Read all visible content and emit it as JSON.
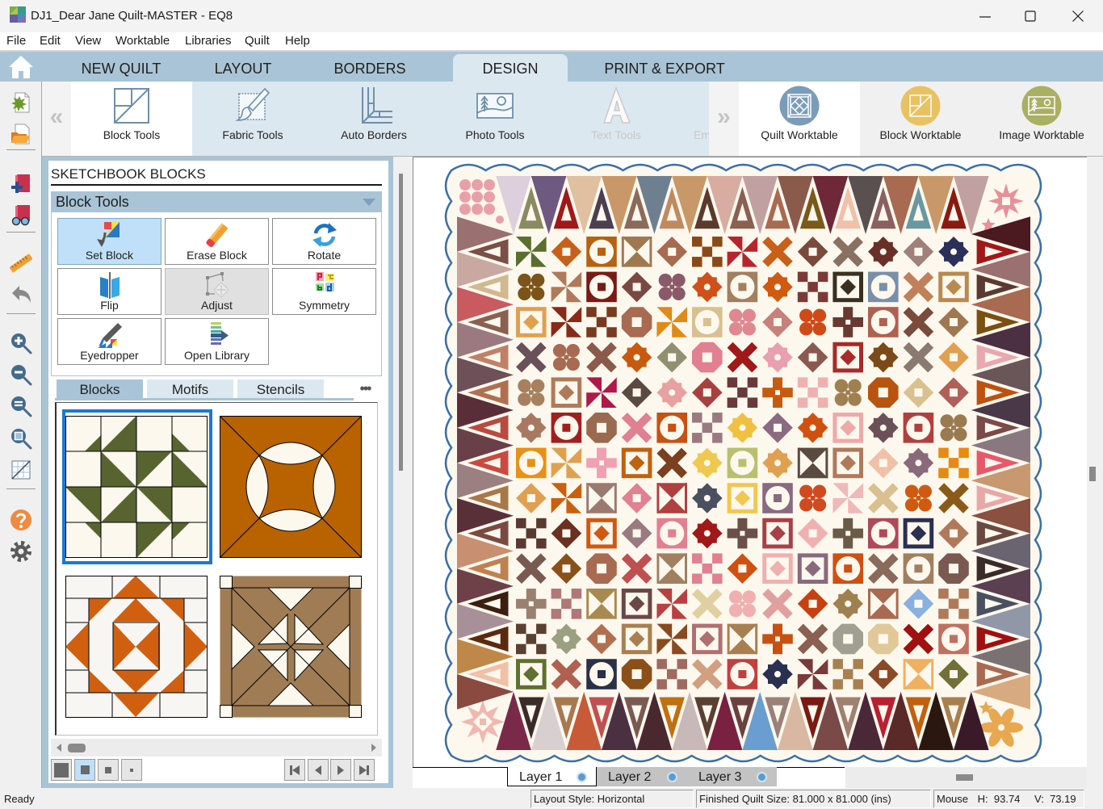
{
  "window": {
    "title": "DJ1_Dear Jane Quilt-MASTER - EQ8",
    "controls": [
      "minimize-icon",
      "maximize-icon",
      "close-icon"
    ]
  },
  "menu": [
    {
      "label": "File"
    },
    {
      "label": "Edit"
    },
    {
      "label": "View"
    },
    {
      "label": "Worktable"
    },
    {
      "label": "Libraries"
    },
    {
      "label": "Quilt"
    },
    {
      "label": "Help"
    }
  ],
  "tabs": [
    {
      "label": "NEW QUILT"
    },
    {
      "label": "LAYOUT"
    },
    {
      "label": "BORDERS"
    },
    {
      "label": "DESIGN",
      "active": true
    },
    {
      "label": "PRINT & EXPORT"
    }
  ],
  "ribbon": {
    "scroll_left": "«",
    "scroll_right": "»",
    "tools": [
      {
        "label": "Block Tools",
        "state": "active"
      },
      {
        "label": "Fabric Tools",
        "state": "normal"
      },
      {
        "label": "Auto Borders",
        "state": "normal"
      },
      {
        "label": "Photo Tools",
        "state": "normal"
      },
      {
        "label": "Text Tools",
        "state": "disabled"
      },
      {
        "label": "Em",
        "state": "disabled"
      }
    ],
    "worktables": [
      {
        "label": "Quilt Worktable",
        "color": "#7a9cb8",
        "state": "active"
      },
      {
        "label": "Block Worktable",
        "color": "#e8c262"
      },
      {
        "label": "Image Worktable",
        "color": "#aab062"
      }
    ]
  },
  "toolbar_left": [
    "new-quilt",
    "open-project",
    "add-to-sketchbook",
    "view-sketchbook",
    "ruler",
    "undo",
    "zoom-in",
    "zoom-out",
    "fit-to-worktable",
    "zoom-window",
    "show-grid",
    "help",
    "settings"
  ],
  "panel": {
    "title": "SKETCHBOOK BLOCKS",
    "section": "Block Tools",
    "tools": [
      {
        "label": "Set Block",
        "state": "active"
      },
      {
        "label": "Erase Block"
      },
      {
        "label": "Rotate"
      },
      {
        "label": "Flip"
      },
      {
        "label": "Adjust",
        "state": "disabled"
      },
      {
        "label": "Symmetry"
      },
      {
        "label": "Eyedropper"
      },
      {
        "label": "Open Library"
      }
    ],
    "tabs": [
      {
        "label": "Blocks",
        "active": true
      },
      {
        "label": "Motifs"
      },
      {
        "label": "Stencils"
      }
    ],
    "more": "•••",
    "thumbnails": [
      {
        "background": "#fdf8ee",
        "color": "#586430",
        "selected": true
      },
      {
        "background": "#b86200",
        "color": "#fdf8ee"
      },
      {
        "background": "#f8f6f2",
        "color": "#d06010"
      },
      {
        "background": "#a07c54",
        "color": "#fdf8ee"
      }
    ],
    "view_sizes": [
      {
        "size": "large"
      },
      {
        "size": "medium",
        "active": true
      },
      {
        "size": "small"
      },
      {
        "size": "tiny"
      }
    ],
    "nav": [
      "first",
      "previous",
      "next",
      "last"
    ]
  },
  "canvas": {
    "quilt": {
      "background": "#fdf8ee",
      "binding": "#3a6ea8",
      "blocks": {
        "colors": [
          [
            "#5a6e2e",
            "#c8601a",
            "#b8620f",
            "#a07850",
            "#a86a50",
            "#8a4a18",
            "#b8242e",
            "#c86018",
            "#7a4a3a",
            "#8a7060",
            "#6a3028",
            "#a08078",
            "#2a3058"
          ],
          [
            "#7a5418",
            "#b07a5a",
            "#7a1a14",
            "#7a4a42",
            "#8a5a68",
            "#d0501a",
            "#a08060",
            "#d05a10",
            "#7a3a38",
            "#3a3020",
            "#7890a8",
            "#c0805a",
            "#b88a50"
          ],
          [
            "#e0a050",
            "#8a2a18",
            "#7a3a20",
            "#a86a50",
            "#e08a18",
            "#d8c090",
            "#e08890",
            "#c8807a",
            "#d04a18",
            "#6a3a30",
            "#b06050",
            "#7a4a3a",
            "#a07850"
          ],
          [
            "#6a5058",
            "#a86a50",
            "#8a5a4a",
            "#c85a10",
            "#909070",
            "#e08090",
            "#a01818",
            "#e8a0b0",
            "#8a5a50",
            "#a82a2a",
            "#7a4a18",
            "#8a7a70",
            "#e0a050"
          ],
          [
            "#a88060",
            "#b07a5a",
            "#b01848",
            "#5a4a40",
            "#e8a0a0",
            "#a84040",
            "#6a3a3a",
            "#c85a10",
            "#f0b0b0",
            "#a08050",
            "#b85410",
            "#d8c090",
            "#b06058"
          ],
          [
            "#a87860",
            "#a02020",
            "#9a6a50",
            "#e08090",
            "#c85010",
            "#9a7a80",
            "#f0c040",
            "#8a6a80",
            "#d05010",
            "#f0a8a8",
            "#6a5058",
            "#b04040",
            "#9a7a50"
          ],
          [
            "#e89018",
            "#e0a050",
            "#f0a0b0",
            "#c06010",
            "#7a4020",
            "#f0c850",
            "#b8c070",
            "#e0a050",
            "#5a4a40",
            "#b07a5a",
            "#f0c0a8",
            "#8a6a7a",
            "#e88a10"
          ],
          [
            "#e0a050",
            "#c86010",
            "#9a7a70",
            "#e08090",
            "#b04040",
            "#4a5060",
            "#f0c850",
            "#8a6a80",
            "#d04a20",
            "#f0b8b8",
            "#d8c090",
            "#d05a10",
            "#8a5a18"
          ],
          [
            "#5a3a30",
            "#6a3020",
            "#d05810",
            "#9a7a80",
            "#e08090",
            "#a01818",
            "#6a5048",
            "#a84048",
            "#f0b0b0",
            "#6a5a48",
            "#b04858",
            "#2a3050",
            "#b07a5a"
          ],
          [
            "#7a5a50",
            "#8a5018",
            "#a86a50",
            "#c05050",
            "#a08060",
            "#e08090",
            "#d05010",
            "#f0b0b0",
            "#8a6a7a",
            "#d05010",
            "#8a6a5a",
            "#a08060",
            "#7a5a50"
          ],
          [
            "#9a8070",
            "#b07878",
            "#a88a50",
            "#6a4848",
            "#b84040",
            "#e0d0a0",
            "#f0b0b0",
            "#e0a0a0",
            "#c84010",
            "#a08050",
            "#a86a50",
            "#88b0e0",
            "#b07a5a"
          ],
          [
            "#5a4030",
            "#9aa080",
            "#b07050",
            "#a88050",
            "#8a4a20",
            "#b07070",
            "#a88050",
            "#c85010",
            "#8a6050",
            "#a0a090",
            "#e0c898",
            "#a01010",
            "#c07060"
          ],
          [
            "#607030",
            "#b06050",
            "#2a3048",
            "#8a5018",
            "#a06a60",
            "#d0a080",
            "#c04040",
            "#2a3050",
            "#7a3a3a",
            "#a88050",
            "#8a4a28",
            "#f0b060",
            "#707038"
          ]
        ],
        "motifs": [
          "PDCHDKPXDXTDT",
          "FPCDFTCTKSCXS",
          "SPKOPCFDF+CXD",
          "XFXTDOXTDSTXD",
          "FSPDTDK+KFODD",
          "TCOXCKTDTSTCF",
          "CP+SXTCTHSDTK",
          "DPHDHTSCFPXFX",
          "KDSDCT+SD+CSD",
          "XDOXHKDSSCXCO",
          "+KHSPXFXDTHDK",
          "KTDSPSH+XOOXC",
          "SXCOKXCTPKDHD"
        ]
      },
      "border_top": {
        "plain": [
          "#ddd0dc",
          "#6e5a80",
          "#e0c0a0",
          "#c89868",
          "#6e8090",
          "#c89868",
          "#d8aca0",
          "#c0a0a0",
          "#8a5a4a",
          "#6e2838",
          "#5a5050",
          "#a86a50",
          "#c89868",
          "#c0a0a0"
        ],
        "patterned": [
          "#8a8a60",
          "#a01818",
          "#4a4050",
          "#8a6a5a",
          "#c08a60",
          "#5a3a2a",
          "#8a6050",
          "#a86a50",
          "#7a5a18",
          "#f0c0a8",
          "#8a6060",
          "#6a98a0",
          "#8a1a10"
        ]
      },
      "border_bottom": {
        "plain": [
          "#7a2a48",
          "#d8d0d0",
          "#c85a38",
          "#4a3040",
          "#4a2830",
          "#c8b8b8",
          "#7a2040",
          "#6a9ed0",
          "#d8b8a0",
          "#7a4a48",
          "#4a2838",
          "#5a2a28",
          "#2a1810",
          "#3a1a28"
        ],
        "patterned": [
          "#3a2a28",
          "#a87850",
          "#c05050",
          "#7a5a50",
          "#c07010",
          "#5a4030",
          "#6a4040",
          "#9a8078",
          "#7a1a10",
          "#a08070",
          "#b82030",
          "#c06010",
          "#a88050"
        ]
      },
      "border_left": {
        "plain": [
          "#9a7070",
          "#c8a8a0",
          "#c85a60",
          "#9a7a80",
          "#6e5058",
          "#5a2e38",
          "#6a4048",
          "#9a8080",
          "#5a3038",
          "#c89070",
          "#6e4048",
          "#a89098",
          "#c08848",
          "#8a4a40"
        ],
        "patterned": [
          "#7a5048",
          "#d0b890",
          "#8a6050",
          "#c08068",
          "#b07050",
          "#b84a40",
          "#c84a40",
          "#a87848",
          "#7a4a40",
          "#c08050",
          "#3a2010",
          "#5a2a10",
          "#f0c0a8"
        ]
      },
      "border_right": {
        "plain": [
          "#4a1a20",
          "#9a7070",
          "#a86a50",
          "#4a3040",
          "#6a5558",
          "#4a3848",
          "#8a7880",
          "#c89870",
          "#8a5040",
          "#6a6470",
          "#5a4050",
          "#9098a8",
          "#7a7272",
          "#d8aa80"
        ],
        "patterned": [
          "#a01818",
          "#5a3a30",
          "#7a5010",
          "#e8a8b0",
          "#c05010",
          "#7a4a48",
          "#e85868",
          "#e8a8a8",
          "#6a4a40",
          "#3a2a28",
          "#4a5060",
          "#a01010",
          "#a86a50"
        ]
      },
      "corners": {
        "top_left": "#e8a0a8",
        "top_right": "#e8909a",
        "bottom_left": "#f0b8b0",
        "bottom_right": "#e8a850"
      }
    },
    "layers": [
      {
        "label": "Layer 1",
        "active": true
      },
      {
        "label": "Layer 2"
      },
      {
        "label": "Layer 3"
      }
    ]
  },
  "status": {
    "ready": "Ready",
    "layout_style": "Layout Style: Horizontal",
    "finished_size": "Finished Quilt Size: 81.000 x 81.000 (ins)",
    "mouse_label": "Mouse",
    "mouse_h": "H:  93.74",
    "mouse_v": "V:  73.19"
  }
}
